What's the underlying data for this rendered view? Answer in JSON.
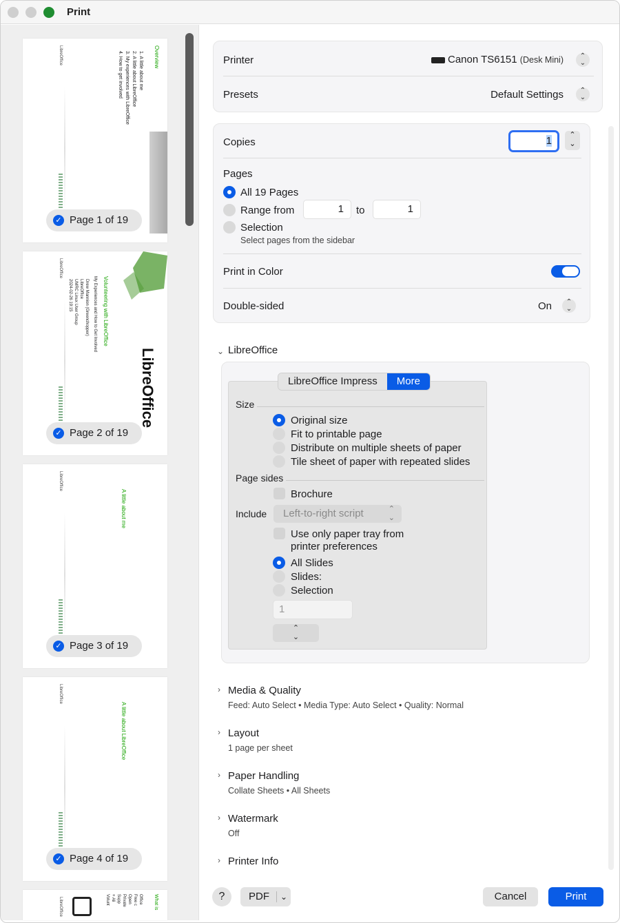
{
  "window": {
    "title": "Print"
  },
  "sidebar": {
    "pages": [
      {
        "label": "Page 1 of 19",
        "lines": [
          "Overview",
          "1. A little about me",
          "2. A little about LibreOffice",
          "3. My experiences with LibreOffice",
          "4. How to get involved"
        ]
      },
      {
        "label": "Page 2 of 19",
        "lines": [
          "Volunteering with LibreOffice",
          "My Experiences and How to Get Involved",
          "Drew Mannion (Greenchopper)",
          "LibreOffice",
          "UMRC Linux User Group",
          "2024-02-26 19:15"
        ],
        "logo": "LibreOffice"
      },
      {
        "label": "Page 3 of 19",
        "lines": [
          "A little about me"
        ]
      },
      {
        "label": "Page 4 of 19",
        "lines": [
          "A little about LibreOffice"
        ]
      }
    ],
    "brand": "LibreOffice",
    "partial_page_lines": [
      "What is",
      "Office",
      "Free c",
      "Open",
      "Private",
      "Supp",
      "+ Ali",
      "Volunt"
    ]
  },
  "printer": {
    "label": "Printer",
    "value": "Canon TS6151",
    "detail": "(Desk Mini)"
  },
  "presets": {
    "label": "Presets",
    "value": "Default Settings"
  },
  "copies": {
    "label": "Copies",
    "value": "1"
  },
  "pages": {
    "label": "Pages",
    "all": "All 19 Pages",
    "range": "Range from",
    "range_from": "1",
    "range_to_label": "to",
    "range_to": "1",
    "selection": "Selection",
    "selection_hint": "Select pages from the sidebar"
  },
  "color": {
    "label": "Print in Color"
  },
  "duplex": {
    "label": "Double-sided",
    "value": "On"
  },
  "libreoffice": {
    "section": "LibreOffice",
    "tabs": [
      "LibreOffice Impress",
      "More"
    ],
    "size_label": "Size",
    "size_options": [
      "Original size",
      "Fit to printable page",
      "Distribute on multiple sheets of paper",
      "Tile sheet of paper with repeated slides"
    ],
    "page_sides_label": "Page sides",
    "brochure": "Brochure",
    "include_label": "Include",
    "include_value": "Left-to-right script",
    "tray_line1": "Use only paper tray from",
    "tray_line2": "printer preferences",
    "slide_options": [
      "All Slides",
      "Slides:",
      "Selection"
    ],
    "slides_input": "1"
  },
  "sections": [
    {
      "title": "Media & Quality",
      "sub": "Feed: Auto Select • Media Type: Auto Select • Quality: Normal"
    },
    {
      "title": "Layout",
      "sub": "1 page per sheet"
    },
    {
      "title": "Paper Handling",
      "sub": "Collate Sheets • All Sheets"
    },
    {
      "title": "Watermark",
      "sub": "Off"
    },
    {
      "title": "Printer Info",
      "sub": ""
    }
  ],
  "footer": {
    "help": "?",
    "pdf": "PDF",
    "cancel": "Cancel",
    "print": "Print"
  }
}
